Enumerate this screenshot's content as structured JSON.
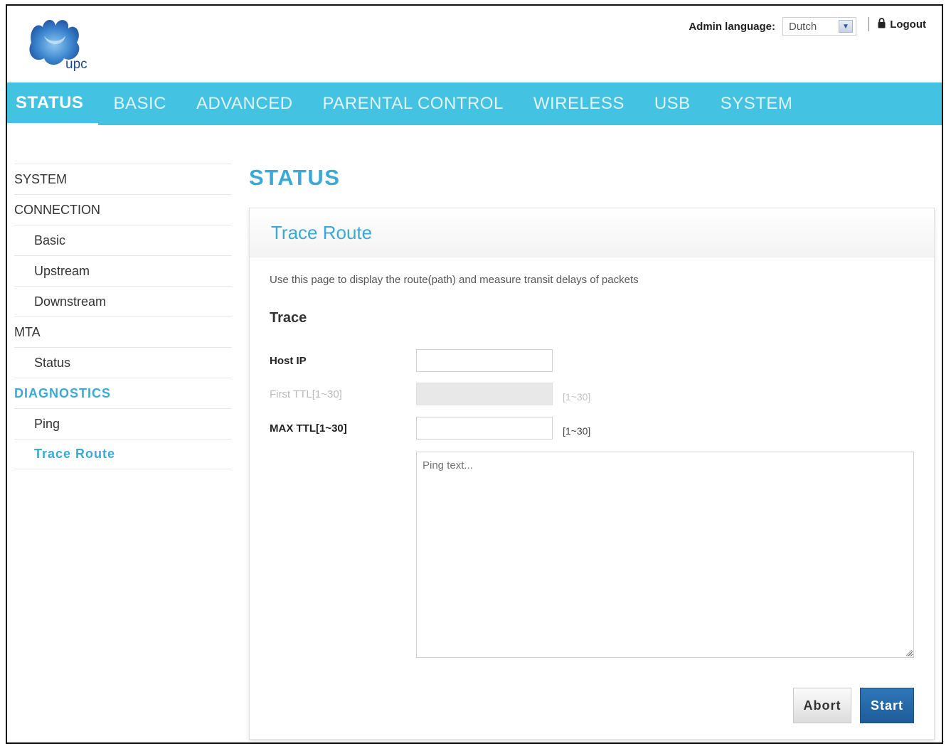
{
  "header": {
    "logo_text": "upc",
    "admin_language_label": "Admin language:",
    "admin_language_value": "Dutch",
    "logout_label": "Logout"
  },
  "nav": {
    "items": [
      {
        "label": "STATUS",
        "active": true
      },
      {
        "label": "BASIC"
      },
      {
        "label": "ADVANCED"
      },
      {
        "label": "PARENTAL CONTROL"
      },
      {
        "label": "WIRELESS"
      },
      {
        "label": "USB"
      },
      {
        "label": "SYSTEM"
      }
    ]
  },
  "sidebar": {
    "items": [
      {
        "label": "SYSTEM"
      },
      {
        "label": "CONNECTION"
      },
      {
        "label": "Basic"
      },
      {
        "label": "Upstream"
      },
      {
        "label": "Downstream"
      },
      {
        "label": "MTA"
      },
      {
        "label": "Status"
      },
      {
        "label": "DIAGNOSTICS"
      },
      {
        "label": "Ping"
      },
      {
        "label": "Trace Route"
      }
    ]
  },
  "main": {
    "page_title": "STATUS",
    "panel_title": "Trace Route",
    "description": "Use this page to display the route(path) and measure transit delays of packets",
    "section_heading": "Trace",
    "host_ip_label": "Host IP",
    "host_ip_value": "",
    "first_ttl_label": "First TTL[1~30]",
    "first_ttl_value": "",
    "first_ttl_hint": "[1~30]",
    "max_ttl_label": "MAX TTL[1~30]",
    "max_ttl_value": "",
    "max_ttl_hint": "[1~30]",
    "ping_text_placeholder": "Ping text...",
    "abort_label": "Abort",
    "start_label": "Start"
  },
  "colors": {
    "accent": "#3aa9d6",
    "nav_bg": "#44c2e1",
    "primary_button": "#1e5c99"
  }
}
